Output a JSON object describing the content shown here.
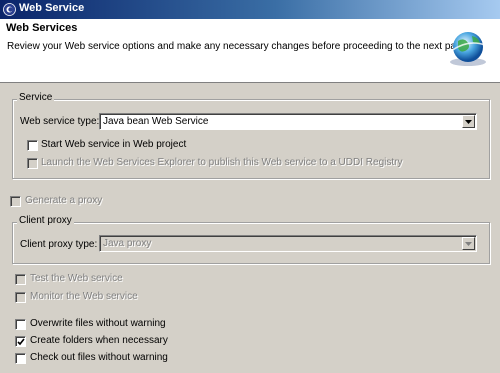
{
  "window": {
    "title": "Web Service"
  },
  "header": {
    "title": "Web Services",
    "description": "Review your Web service options and make any necessary changes before proceeding to the next page."
  },
  "service_group": {
    "legend": "Service",
    "type_label": "Web service type:",
    "type_value": "Java bean Web Service",
    "start_label": "Start Web service in Web project",
    "start_checked": false,
    "launch_label": "Launch the Web Services Explorer to publish this Web service to a UDDI Registry",
    "launch_checked": false
  },
  "generate_proxy": {
    "label": "Generate a proxy",
    "checked": false
  },
  "client_group": {
    "legend": "Client proxy",
    "type_label": "Client proxy type:",
    "type_value": "Java proxy"
  },
  "test_service": {
    "label": "Test the Web service",
    "checked": false
  },
  "monitor_service": {
    "label": "Monitor the Web service",
    "checked": false
  },
  "overwrite": {
    "label": "Overwrite files without warning",
    "checked": false
  },
  "create_folders": {
    "label": "Create folders when necessary",
    "checked": true
  },
  "checkout": {
    "label": "Check out files without warning",
    "checked": false
  }
}
